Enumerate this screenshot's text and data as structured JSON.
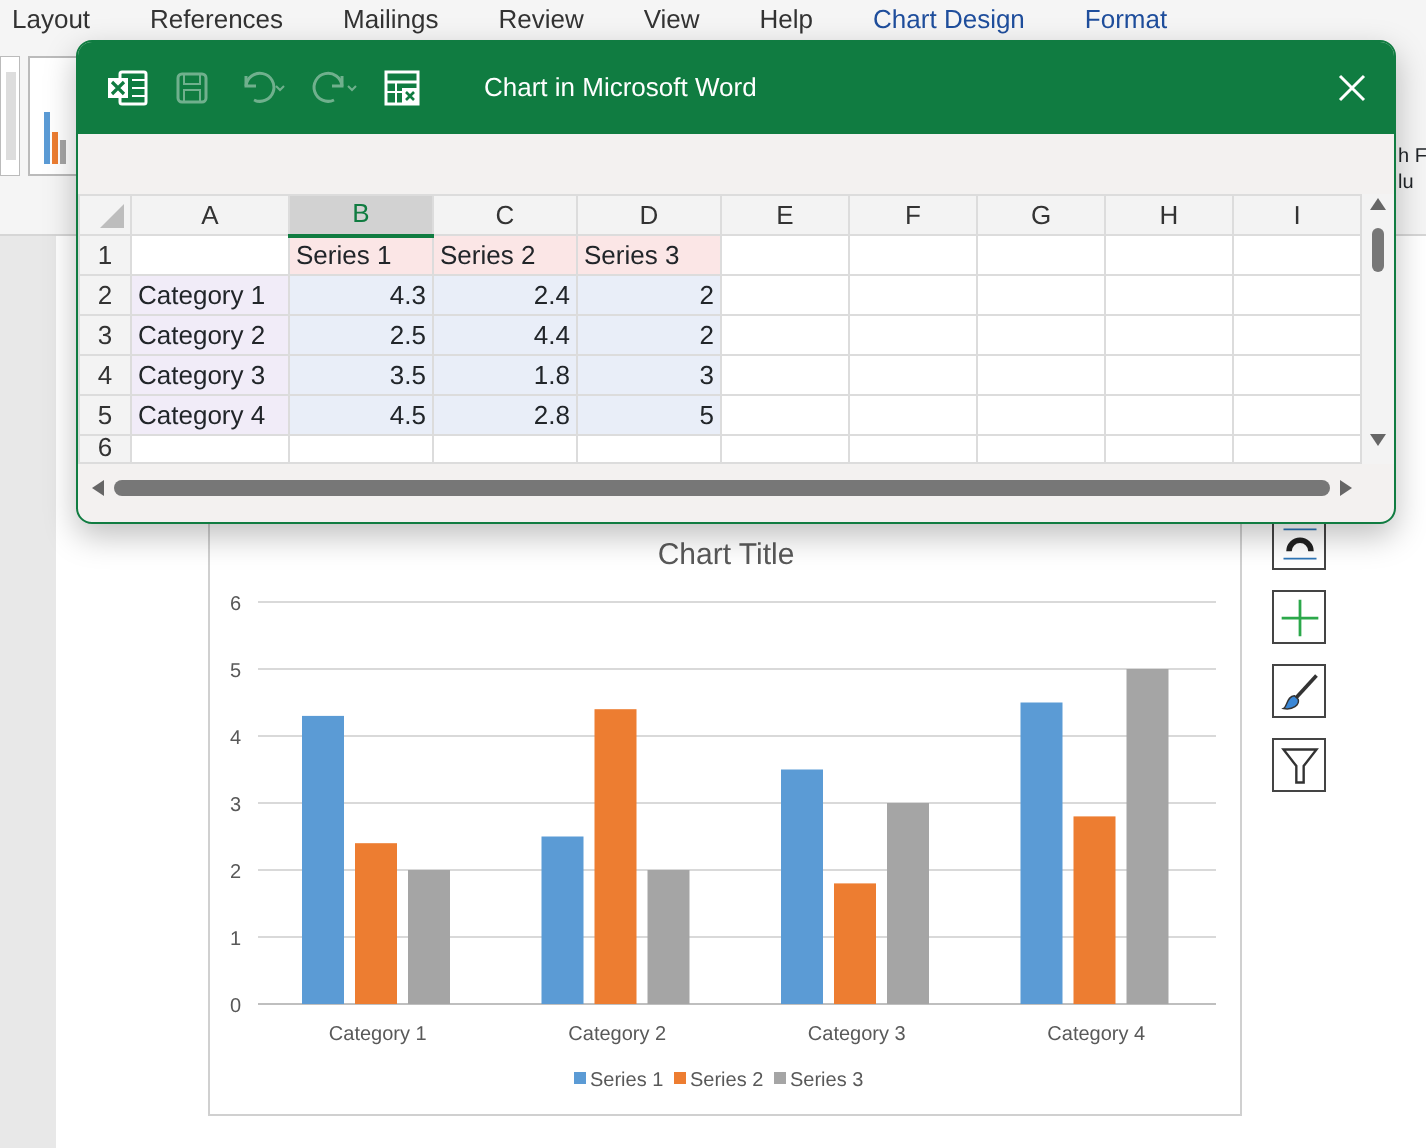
{
  "ribbon": {
    "tabs": [
      {
        "label": "Layout",
        "contextual": false
      },
      {
        "label": "References",
        "contextual": false
      },
      {
        "label": "Mailings",
        "contextual": false
      },
      {
        "label": "Review",
        "contextual": false
      },
      {
        "label": "View",
        "contextual": false
      },
      {
        "label": "Help",
        "contextual": false
      },
      {
        "label": "Chart Design",
        "contextual": true
      },
      {
        "label": "Format",
        "contextual": true
      }
    ],
    "right_button": [
      "h F",
      "lu"
    ]
  },
  "dialog": {
    "title": "Chart in Microsoft Word",
    "toolbar": [
      {
        "kind": "excel",
        "disabled": false
      },
      {
        "kind": "save",
        "disabled": true
      },
      {
        "kind": "undo",
        "disabled": true
      },
      {
        "kind": "redo",
        "disabled": true
      },
      {
        "kind": "table",
        "disabled": false
      }
    ],
    "sheet": {
      "columns": [
        {
          "label": "A",
          "selected": false
        },
        {
          "label": "B",
          "selected": true
        },
        {
          "label": "C",
          "selected": false
        },
        {
          "label": "D",
          "selected": false
        },
        {
          "label": "E",
          "selected": false
        },
        {
          "label": "F",
          "selected": false
        },
        {
          "label": "G",
          "selected": false
        },
        {
          "label": "H",
          "selected": false
        },
        {
          "label": "I",
          "selected": false
        }
      ],
      "rows": [
        {
          "number": "1",
          "cells": [
            null,
            {
              "text": "Series 1",
              "kind": "series"
            },
            {
              "text": "Series 2",
              "kind": "series"
            },
            {
              "text": "Series 3",
              "kind": "series"
            }
          ]
        },
        {
          "number": "2",
          "cells": [
            {
              "text": "Category 1",
              "kind": "category"
            },
            {
              "text": "4.3",
              "kind": "value"
            },
            {
              "text": "2.4",
              "kind": "value"
            },
            {
              "text": "2",
              "kind": "value"
            }
          ]
        },
        {
          "number": "3",
          "cells": [
            {
              "text": "Category 2",
              "kind": "category"
            },
            {
              "text": "2.5",
              "kind": "value"
            },
            {
              "text": "4.4",
              "kind": "value"
            },
            {
              "text": "2",
              "kind": "value"
            }
          ]
        },
        {
          "number": "4",
          "cells": [
            {
              "text": "Category 3",
              "kind": "category"
            },
            {
              "text": "3.5",
              "kind": "value"
            },
            {
              "text": "1.8",
              "kind": "value"
            },
            {
              "text": "3",
              "kind": "value"
            }
          ]
        },
        {
          "number": "5",
          "cells": [
            {
              "text": "Category 4",
              "kind": "category"
            },
            {
              "text": "4.5",
              "kind": "value"
            },
            {
              "text": "2.8",
              "kind": "value"
            },
            {
              "text": "5",
              "kind": "value"
            }
          ]
        },
        {
          "number": "6",
          "cells": []
        }
      ]
    }
  },
  "chart": {
    "chart_data": {
      "type": "bar",
      "title": "Chart Title",
      "categories": [
        "Category 1",
        "Category 2",
        "Category 3",
        "Category 4"
      ],
      "series": [
        {
          "name": "Series 1",
          "color": "#5b9bd5",
          "values": [
            4.3,
            2.5,
            3.5,
            4.5
          ]
        },
        {
          "name": "Series 2",
          "color": "#ed7d31",
          "values": [
            2.4,
            4.4,
            1.8,
            2.8
          ]
        },
        {
          "name": "Series 3",
          "color": "#a5a5a5",
          "values": [
            2,
            2,
            3,
            5
          ]
        }
      ],
      "ylim": [
        0,
        6
      ],
      "yticks": [
        0,
        1,
        2,
        3,
        4,
        5,
        6
      ],
      "grid": true,
      "legend": true
    },
    "side_buttons": [
      {
        "kind": "layout"
      },
      {
        "kind": "add"
      },
      {
        "kind": "style"
      },
      {
        "kind": "filter"
      }
    ]
  }
}
